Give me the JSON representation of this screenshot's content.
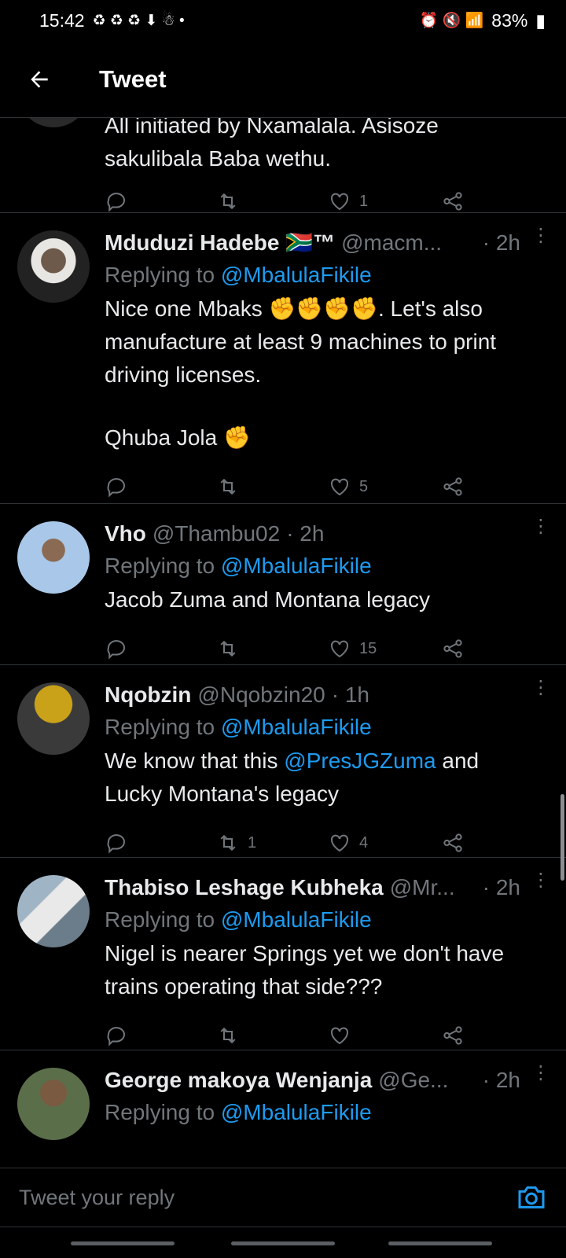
{
  "status_bar": {
    "time": "15:42",
    "battery": "83%"
  },
  "header": {
    "title": "Tweet"
  },
  "partial_tweet": {
    "text_line1": "All initiated by Nxamalala. Asisoze",
    "text_line2": "sakulibala Baba wethu.",
    "likes": "1"
  },
  "tweets": [
    {
      "name": "Mduduzi Hadebe 🇿🇦™",
      "handle": "@macm...",
      "time": "· 2h",
      "replying_prefix": "Replying to ",
      "replying_to": "@MbalulaFikile",
      "text_line1": "Nice one Mbaks ✊✊✊✊. Let's also",
      "text_line2": "manufacture at least 9 machines to print",
      "text_line3": "driving licenses.",
      "text_line4": "Qhuba Jola ✊",
      "retweets": "",
      "likes": "5"
    },
    {
      "name": "Vho",
      "handle": "@Thambu02",
      "time": "· 2h",
      "replying_prefix": "Replying to ",
      "replying_to": "@MbalulaFikile",
      "text_line1": "Jacob Zuma and Montana legacy",
      "retweets": "",
      "likes": "15"
    },
    {
      "name": "Nqobzin",
      "handle": "@Nqobzin20",
      "time": "· 1h",
      "replying_prefix": "Replying to ",
      "replying_to": "@MbalulaFikile",
      "text_a": "We know that this ",
      "text_mention": "@PresJGZuma",
      "text_b": " and",
      "text_line2": "Lucky Montana's legacy",
      "retweets": "1",
      "likes": "4"
    },
    {
      "name": "Thabiso Leshage Kubheka",
      "handle": "@Mr...",
      "time": "· 2h",
      "replying_prefix": "Replying to ",
      "replying_to": "@MbalulaFikile",
      "text_line1": "Nigel is nearer Springs yet we don't have",
      "text_line2": "trains operating that side???",
      "retweets": "",
      "likes": ""
    },
    {
      "name": "George makoya Wenjanja",
      "handle": "@Ge...",
      "time": "· 2h",
      "replying_prefix": "Replying to ",
      "replying_to": "@MbalulaFikile"
    }
  ],
  "reply_bar": {
    "placeholder": "Tweet your reply"
  },
  "colors": {
    "accent": "#1d9bf0",
    "muted": "#71767b",
    "background": "#000000",
    "text": "#e7e9ea"
  },
  "icons": [
    "back-arrow-icon",
    "reply-icon",
    "retweet-icon",
    "like-icon",
    "share-icon",
    "more-icon",
    "camera-icon"
  ]
}
